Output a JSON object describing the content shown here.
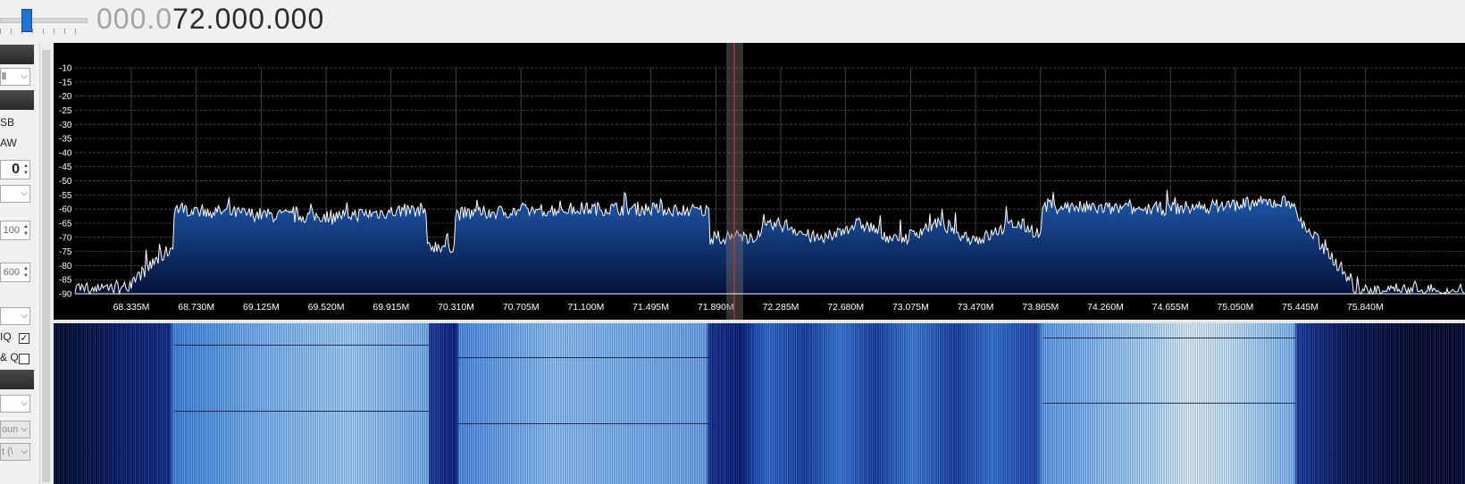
{
  "frequency": {
    "dim": "000.0",
    "bright": "72.000.000"
  },
  "left_panel": {
    "combo_top": "ll",
    "mode_usb": "SB",
    "mode_raw": "AW",
    "spin_gain": "0",
    "spin_bw1": "100",
    "spin_bw2": "600",
    "swap_iq_label": "IQ",
    "swap_iq_checked": "✓",
    "iq_label": "& Q",
    "combo_dis1": "oun",
    "combo_dis2": "t (\\"
  },
  "spectrum": {
    "db_labels": [
      "-10",
      "-15",
      "-20",
      "-25",
      "-30",
      "-35",
      "-40",
      "-45",
      "-50",
      "-55",
      "-60",
      "-65",
      "-70",
      "-75",
      "-80",
      "-85",
      "-90"
    ],
    "freq_labels": [
      "68.335M",
      "68.730M",
      "69.125M",
      "69.520M",
      "69.915M",
      "70.310M",
      "70.705M",
      "71.100M",
      "71.495M",
      "71.890M",
      "72.285M",
      "72.680M",
      "73.075M",
      "73.470M",
      "73.865M",
      "74.260M",
      "74.655M",
      "75.050M",
      "75.445M",
      "75.840M"
    ],
    "trace_color": "#ffffff",
    "fill_top_color": "#1f5bb0",
    "fill_bottom_color": "#04123a",
    "marker_color": "#d83030"
  }
}
